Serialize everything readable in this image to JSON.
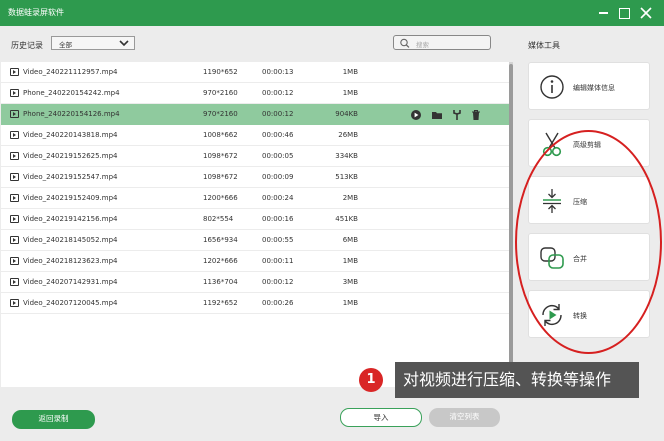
{
  "window": {
    "title": "数据蛙录屏软件"
  },
  "filter": {
    "label": "历史记录",
    "selected": "全部",
    "search_placeholder": "搜索"
  },
  "files": [
    {
      "name": "Video_240221112957.mp4",
      "resolution": "1190*652",
      "duration": "00:00:13",
      "size": "1MB"
    },
    {
      "name": "Phone_240220154242.mp4",
      "resolution": "970*2160",
      "duration": "00:00:12",
      "size": "1MB"
    },
    {
      "name": "Phone_240220154126.mp4",
      "resolution": "970*2160",
      "duration": "00:00:12",
      "size": "904KB",
      "selected": true
    },
    {
      "name": "Video_240220143818.mp4",
      "resolution": "1008*662",
      "duration": "00:00:46",
      "size": "26MB"
    },
    {
      "name": "Video_240219152625.mp4",
      "resolution": "1098*672",
      "duration": "00:00:05",
      "size": "334KB"
    },
    {
      "name": "Video_240219152547.mp4",
      "resolution": "1098*672",
      "duration": "00:00:09",
      "size": "513KB"
    },
    {
      "name": "Video_240219152409.mp4",
      "resolution": "1200*666",
      "duration": "00:00:24",
      "size": "2MB"
    },
    {
      "name": "Video_240219142156.mp4",
      "resolution": "802*554",
      "duration": "00:00:16",
      "size": "451KB"
    },
    {
      "name": "Video_240218145052.mp4",
      "resolution": "1656*934",
      "duration": "00:00:55",
      "size": "6MB"
    },
    {
      "name": "Video_240218123623.mp4",
      "resolution": "1202*666",
      "duration": "00:00:11",
      "size": "1MB"
    },
    {
      "name": "Video_240207142931.mp4",
      "resolution": "1136*704",
      "duration": "00:00:12",
      "size": "3MB"
    },
    {
      "name": "Video_240207120045.mp4",
      "resolution": "1192*652",
      "duration": "00:00:26",
      "size": "1MB"
    }
  ],
  "row_actions": [
    "play-icon",
    "folder-icon",
    "wrench-icon",
    "trash-icon"
  ],
  "tools": {
    "title": "媒体工具",
    "items": [
      {
        "label": "编辑媒体信息",
        "icon": "info-icon"
      },
      {
        "label": "高级剪辑",
        "icon": "scissors-icon"
      },
      {
        "label": "压缩",
        "icon": "compress-icon"
      },
      {
        "label": "合并",
        "icon": "merge-icon"
      },
      {
        "label": "转换",
        "icon": "convert-icon"
      }
    ]
  },
  "annotation": {
    "number": "1",
    "text": "对视频进行压缩、转换等操作"
  },
  "buttons": {
    "back": "返回录制",
    "import": "导入",
    "clear": "清空列表"
  },
  "colors": {
    "accent": "#2e9a4e",
    "selected_row": "#8fca9e",
    "annotation_red": "#d92626"
  }
}
